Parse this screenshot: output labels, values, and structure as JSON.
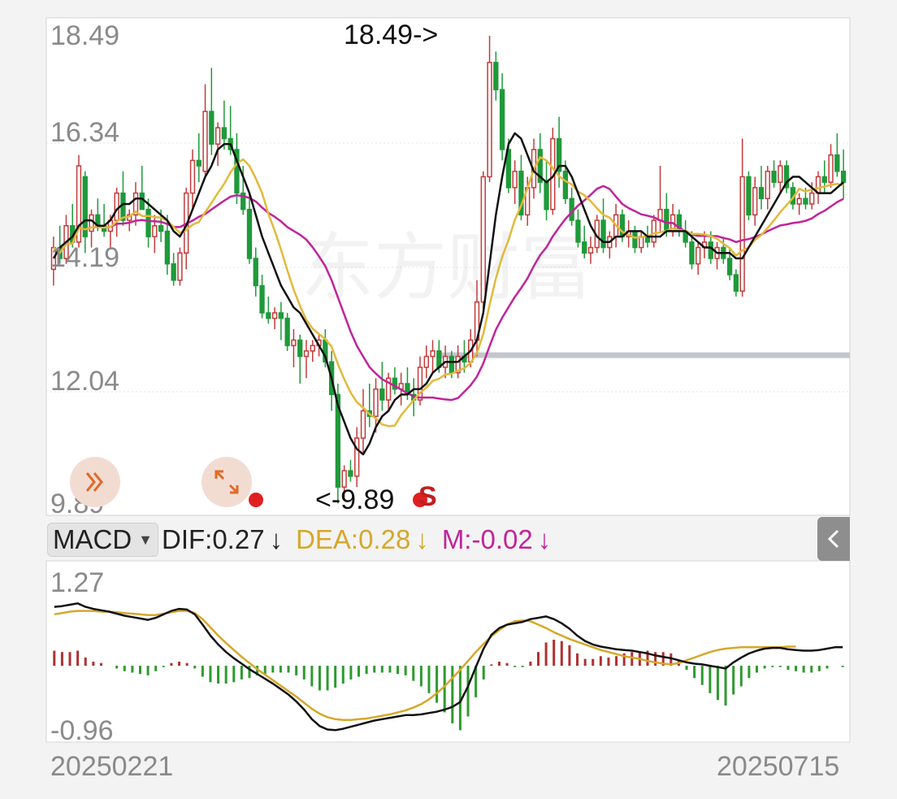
{
  "header": {
    "indicator": "MACD"
  },
  "price_axis": {
    "labels": [
      "18.49",
      "16.34",
      "14.19",
      "12.04",
      "9.89"
    ]
  },
  "annotations": {
    "high": "18.49->",
    "low": "<-9.89",
    "signal": "S",
    "watermark": "东方财富"
  },
  "macd_info": {
    "dif": "DIF:0.27",
    "dea": "DEA:0.28",
    "m": "M:-0.02",
    "arrow": "↓"
  },
  "macd_axis": {
    "top": "1.27",
    "bottom": "-0.96"
  },
  "dates": {
    "start": "20250221",
    "end": "20250715"
  },
  "icons": {
    "forward": "double-chevron-right-icon",
    "expand": "expand-arrows-icon",
    "collapse": "chevron-left-icon"
  },
  "colors": {
    "up": "#c23b3b",
    "down": "#1f9a3a",
    "ma5": "#111111",
    "ma10": "#e2b93b",
    "ma20": "#c0249a",
    "dea": "#d6a72a",
    "macd_up": "#b03030",
    "macd_down": "#2e9a2e",
    "dot": "#e02020",
    "grid": "#dddddd",
    "hline": "#c4c4c4"
  },
  "chart_data": [
    {
      "type": "candlestick",
      "title": "",
      "ylim": [
        9.89,
        18.49
      ],
      "y_ticks": [
        18.49,
        16.34,
        14.19,
        12.04,
        9.89
      ],
      "x_range": [
        "20250221",
        "20250715"
      ],
      "grid": true,
      "candles": [
        [
          14.2,
          14.8,
          13.9,
          14.6
        ],
        [
          14.6,
          15.0,
          14.3,
          14.4
        ],
        [
          14.4,
          15.2,
          14.3,
          15.0
        ],
        [
          15.0,
          15.4,
          14.6,
          14.7
        ],
        [
          14.7,
          16.3,
          14.6,
          16.1
        ],
        [
          15.9,
          16.0,
          14.5,
          14.8
        ],
        [
          14.9,
          15.3,
          14.6,
          15.2
        ],
        [
          15.2,
          15.5,
          14.9,
          15.0
        ],
        [
          15.0,
          15.4,
          14.8,
          14.9
        ],
        [
          14.9,
          15.2,
          14.6,
          15.1
        ],
        [
          15.1,
          15.7,
          14.8,
          15.6
        ],
        [
          15.6,
          16.0,
          15.0,
          15.1
        ],
        [
          15.1,
          15.3,
          14.9,
          15.2
        ],
        [
          15.2,
          15.8,
          15.0,
          15.6
        ],
        [
          15.6,
          16.1,
          15.4,
          15.3
        ],
        [
          15.3,
          15.5,
          14.6,
          14.8
        ],
        [
          14.8,
          15.2,
          14.5,
          15.0
        ],
        [
          15.0,
          15.3,
          14.7,
          14.9
        ],
        [
          14.9,
          15.2,
          14.1,
          14.3
        ],
        [
          14.3,
          14.5,
          13.9,
          14.0
        ],
        [
          14.0,
          14.6,
          13.9,
          14.5
        ],
        [
          14.5,
          15.7,
          14.2,
          15.6
        ],
        [
          15.6,
          16.4,
          15.3,
          16.2
        ],
        [
          16.2,
          16.7,
          15.8,
          16.1
        ],
        [
          16.0,
          17.6,
          15.9,
          17.1
        ],
        [
          17.1,
          17.9,
          16.3,
          16.5
        ],
        [
          16.5,
          16.9,
          16.1,
          16.8
        ],
        [
          16.8,
          17.3,
          16.4,
          16.6
        ],
        [
          16.6,
          17.2,
          16.3,
          16.4
        ],
        [
          16.4,
          16.7,
          15.4,
          15.6
        ],
        [
          15.6,
          16.1,
          15.2,
          15.3
        ],
        [
          15.3,
          15.6,
          14.3,
          14.4
        ],
        [
          14.4,
          14.6,
          13.7,
          13.9
        ],
        [
          13.9,
          14.1,
          13.3,
          13.4
        ],
        [
          13.4,
          13.7,
          13.2,
          13.3
        ],
        [
          13.3,
          13.5,
          13.1,
          13.4
        ],
        [
          13.4,
          13.6,
          12.9,
          13.3
        ],
        [
          13.3,
          13.4,
          12.7,
          12.8
        ],
        [
          12.8,
          13.1,
          12.4,
          12.9
        ],
        [
          12.9,
          13.0,
          12.1,
          12.6
        ],
        [
          12.6,
          12.9,
          12.2,
          12.7
        ],
        [
          12.7,
          12.9,
          12.5,
          12.8
        ],
        [
          12.8,
          13.0,
          12.6,
          12.9
        ],
        [
          12.9,
          13.1,
          12.4,
          12.5
        ],
        [
          12.5,
          12.7,
          11.6,
          11.9
        ],
        [
          11.9,
          12.1,
          9.9,
          10.2
        ],
        [
          10.2,
          10.6,
          10.0,
          10.5
        ],
        [
          10.5,
          10.7,
          10.3,
          10.4
        ],
        [
          10.4,
          11.3,
          10.2,
          11.1
        ],
        [
          11.1,
          12.0,
          10.8,
          11.6
        ],
        [
          11.6,
          12.1,
          11.3,
          11.5
        ],
        [
          11.5,
          12.2,
          11.2,
          12.0
        ],
        [
          12.0,
          12.5,
          11.6,
          11.8
        ],
        [
          11.8,
          12.3,
          11.6,
          12.2
        ],
        [
          12.2,
          12.4,
          11.9,
          12.0
        ],
        [
          12.0,
          12.3,
          11.7,
          12.1
        ],
        [
          12.1,
          12.4,
          11.8,
          11.9
        ],
        [
          11.9,
          12.2,
          11.5,
          11.8
        ],
        [
          11.8,
          12.6,
          11.7,
          12.4
        ],
        [
          12.4,
          12.8,
          12.2,
          12.6
        ],
        [
          12.6,
          12.9,
          12.3,
          12.7
        ],
        [
          12.7,
          12.9,
          12.3,
          12.4
        ],
        [
          12.4,
          12.8,
          12.2,
          12.6
        ],
        [
          12.6,
          12.7,
          12.2,
          12.3
        ],
        [
          12.3,
          12.8,
          12.2,
          12.6
        ],
        [
          12.6,
          12.9,
          12.3,
          12.5
        ],
        [
          12.5,
          13.1,
          12.4,
          12.9
        ],
        [
          12.9,
          14.0,
          12.6,
          13.6
        ],
        [
          13.6,
          16.0,
          13.4,
          15.9
        ],
        [
          15.9,
          18.49,
          15.8,
          18.0
        ],
        [
          18.0,
          18.2,
          17.3,
          17.5
        ],
        [
          17.5,
          17.8,
          16.2,
          16.4
        ],
        [
          16.4,
          16.6,
          15.6,
          15.7
        ],
        [
          15.7,
          16.2,
          15.4,
          16.0
        ],
        [
          16.0,
          16.3,
          15.1,
          15.2
        ],
        [
          15.2,
          15.9,
          15.0,
          15.7
        ],
        [
          15.7,
          16.6,
          15.5,
          16.4
        ],
        [
          16.4,
          16.7,
          15.6,
          15.8
        ],
        [
          15.8,
          16.2,
          15.1,
          15.3
        ],
        [
          15.3,
          16.8,
          15.2,
          16.6
        ],
        [
          16.6,
          17.0,
          15.7,
          16.0
        ],
        [
          16.0,
          16.2,
          15.4,
          15.5
        ],
        [
          15.5,
          15.7,
          15.0,
          15.1
        ],
        [
          15.1,
          15.3,
          14.6,
          14.7
        ],
        [
          14.7,
          15.0,
          14.4,
          14.5
        ],
        [
          14.5,
          14.8,
          14.3,
          14.6
        ],
        [
          14.6,
          15.2,
          14.5,
          15.1
        ],
        [
          15.1,
          15.5,
          14.5,
          14.6
        ],
        [
          14.6,
          14.9,
          14.4,
          14.8
        ],
        [
          14.8,
          15.4,
          14.6,
          15.2
        ],
        [
          15.2,
          15.3,
          14.7,
          14.8
        ],
        [
          14.8,
          15.1,
          14.6,
          14.9
        ],
        [
          14.9,
          15.0,
          14.5,
          14.6
        ],
        [
          14.6,
          14.9,
          14.5,
          14.8
        ],
        [
          14.8,
          15.0,
          14.6,
          14.7
        ],
        [
          14.7,
          15.2,
          14.6,
          15.1
        ],
        [
          15.1,
          16.1,
          14.9,
          15.3
        ],
        [
          15.3,
          15.6,
          14.8,
          14.9
        ],
        [
          14.9,
          15.4,
          14.8,
          15.2
        ],
        [
          15.2,
          15.3,
          14.8,
          14.9
        ],
        [
          14.9,
          15.1,
          14.6,
          14.7
        ],
        [
          14.7,
          14.9,
          14.2,
          14.3
        ],
        [
          14.3,
          14.7,
          14.1,
          14.6
        ],
        [
          14.6,
          14.9,
          14.4,
          14.7
        ],
        [
          14.7,
          14.9,
          14.3,
          14.4
        ],
        [
          14.4,
          14.7,
          14.2,
          14.6
        ],
        [
          14.6,
          14.8,
          14.3,
          14.4
        ],
        [
          14.4,
          14.6,
          14.0,
          14.1
        ],
        [
          14.1,
          14.2,
          13.7,
          13.8
        ],
        [
          13.8,
          16.6,
          13.7,
          15.9
        ],
        [
          15.9,
          16.0,
          15.1,
          15.2
        ],
        [
          15.2,
          15.9,
          15.0,
          15.7
        ],
        [
          15.7,
          16.1,
          15.3,
          15.5
        ],
        [
          15.5,
          16.1,
          15.3,
          16.0
        ],
        [
          16.0,
          16.2,
          15.7,
          15.8
        ],
        [
          15.8,
          16.2,
          15.6,
          16.1
        ],
        [
          16.1,
          16.2,
          15.6,
          15.7
        ],
        [
          15.7,
          15.8,
          15.3,
          15.4
        ],
        [
          15.4,
          15.6,
          15.2,
          15.5
        ],
        [
          15.5,
          15.7,
          15.3,
          15.4
        ],
        [
          15.4,
          15.8,
          15.3,
          15.6
        ],
        [
          15.6,
          16.0,
          15.4,
          15.9
        ],
        [
          15.9,
          16.2,
          15.6,
          15.8
        ],
        [
          15.8,
          16.5,
          15.7,
          16.3
        ],
        [
          16.3,
          16.7,
          15.9,
          16.0
        ],
        [
          16.0,
          16.4,
          15.5,
          15.8
        ]
      ],
      "ma5": [
        14.4,
        14.6,
        14.7,
        14.8,
        15.0,
        15.1,
        15.1,
        15.0,
        15.0,
        15.1,
        15.3,
        15.4,
        15.4,
        15.5,
        15.5,
        15.4,
        15.3,
        15.2,
        15.1,
        14.9,
        14.8,
        15.0,
        15.3,
        15.6,
        15.9,
        16.1,
        16.4,
        16.5,
        16.5,
        16.2,
        15.9,
        15.6,
        15.2,
        14.8,
        14.5,
        14.2,
        13.9,
        13.7,
        13.5,
        13.4,
        13.2,
        13.0,
        12.8,
        12.6,
        12.2,
        11.7,
        11.4,
        11.1,
        10.9,
        10.8,
        11.0,
        11.3,
        11.5,
        11.6,
        11.8,
        11.9,
        11.9,
        12.0,
        12.0,
        12.1,
        12.3,
        12.4,
        12.5,
        12.5,
        12.5,
        12.6,
        12.7,
        12.9,
        13.4,
        14.3,
        15.2,
        15.9,
        16.5,
        16.7,
        16.6,
        16.3,
        16.0,
        15.9,
        15.8,
        15.9,
        16.1,
        16.1,
        15.9,
        15.6,
        15.3,
        15.0,
        14.8,
        14.7,
        14.7,
        14.8,
        14.8,
        14.9,
        14.9,
        14.9,
        14.8,
        14.8,
        14.8,
        14.9,
        14.9,
        14.9,
        14.9,
        14.8,
        14.7,
        14.6,
        14.6,
        14.5,
        14.5,
        14.5,
        14.4,
        14.4,
        14.6,
        14.8,
        15.0,
        15.2,
        15.4,
        15.6,
        15.8,
        15.9,
        15.9,
        15.8,
        15.7,
        15.6,
        15.6,
        15.6,
        15.7,
        15.8,
        15.8,
        15.8
      ]
    },
    {
      "type": "bar",
      "title": "MACD",
      "ylim": [
        -0.96,
        1.27
      ],
      "series": [
        {
          "name": "DIF",
          "values": [
            0.86,
            0.87,
            0.89,
            0.91,
            0.86,
            0.83,
            0.81,
            0.79,
            0.76,
            0.73,
            0.71,
            0.69,
            0.67,
            0.7,
            0.75,
            0.8,
            0.83,
            0.82,
            0.75,
            0.6,
            0.44,
            0.31,
            0.2,
            0.11,
            0.03,
            -0.05,
            -0.12,
            -0.19,
            -0.26,
            -0.34,
            -0.42,
            -0.52,
            -0.64,
            -0.78,
            -0.88,
            -0.93,
            -0.94,
            -0.92,
            -0.89,
            -0.86,
            -0.83,
            -0.8,
            -0.78,
            -0.76,
            -0.74,
            -0.72,
            -0.72,
            -0.71,
            -0.69,
            -0.67,
            -0.64,
            -0.6,
            -0.53,
            -0.3,
            -0.02,
            0.25,
            0.45,
            0.55,
            0.6,
            0.62,
            0.64,
            0.68,
            0.7,
            0.72,
            0.68,
            0.62,
            0.54,
            0.44,
            0.36,
            0.31,
            0.28,
            0.26,
            0.24,
            0.23,
            0.22,
            0.2,
            0.18,
            0.15,
            0.13,
            0.11,
            0.08,
            0.05,
            0.03,
            0.02,
            0.0,
            -0.02,
            -0.04,
            0.05,
            0.12,
            0.18,
            0.22,
            0.25,
            0.26,
            0.26,
            0.24,
            0.23,
            0.22,
            0.22,
            0.23,
            0.25,
            0.27,
            0.27
          ]
        },
        {
          "name": "DEA",
          "values": [
            0.75,
            0.77,
            0.79,
            0.8,
            0.8,
            0.8,
            0.79,
            0.79,
            0.78,
            0.77,
            0.76,
            0.75,
            0.74,
            0.74,
            0.76,
            0.78,
            0.8,
            0.8,
            0.77,
            0.68,
            0.56,
            0.44,
            0.33,
            0.23,
            0.13,
            0.04,
            -0.05,
            -0.13,
            -0.21,
            -0.29,
            -0.37,
            -0.45,
            -0.54,
            -0.63,
            -0.7,
            -0.75,
            -0.78,
            -0.79,
            -0.79,
            -0.78,
            -0.77,
            -0.75,
            -0.73,
            -0.71,
            -0.68,
            -0.65,
            -0.61,
            -0.56,
            -0.49,
            -0.4,
            -0.3,
            -0.18,
            -0.06,
            0.07,
            0.2,
            0.32,
            0.43,
            0.52,
            0.6,
            0.65,
            0.66,
            0.65,
            0.6,
            0.55,
            0.49,
            0.44,
            0.39,
            0.35,
            0.31,
            0.27,
            0.23,
            0.2,
            0.17,
            0.14,
            0.12,
            0.1,
            0.07,
            0.05,
            0.03,
            0.02,
            0.04,
            0.08,
            0.12,
            0.16,
            0.2,
            0.23,
            0.25,
            0.26,
            0.27,
            0.27,
            0.27,
            0.27,
            0.27,
            0.27,
            0.28,
            0.28
          ]
        },
        {
          "name": "M",
          "values": [
            0.22,
            0.2,
            0.2,
            0.22,
            0.12,
            0.06,
            0.04,
            0.0,
            -0.04,
            -0.08,
            -0.1,
            -0.12,
            -0.14,
            -0.08,
            -0.02,
            0.04,
            0.06,
            0.04,
            -0.04,
            -0.16,
            -0.24,
            -0.26,
            -0.26,
            -0.24,
            -0.2,
            -0.18,
            -0.14,
            -0.12,
            -0.1,
            -0.1,
            -0.1,
            -0.14,
            -0.2,
            -0.3,
            -0.36,
            -0.36,
            -0.32,
            -0.26,
            -0.2,
            -0.16,
            -0.12,
            -0.1,
            -0.1,
            -0.1,
            -0.12,
            -0.14,
            -0.22,
            -0.3,
            -0.4,
            -0.54,
            -0.68,
            -0.84,
            -0.94,
            -0.74,
            -0.46,
            -0.2,
            0.02,
            0.06,
            0.04,
            -0.02,
            -0.02,
            0.06,
            0.2,
            0.34,
            0.38,
            0.36,
            0.3,
            0.18,
            0.1,
            0.1,
            0.14,
            0.12,
            0.14,
            0.18,
            0.2,
            0.2,
            0.22,
            0.2,
            0.2,
            0.18,
            0.08,
            -0.06,
            -0.18,
            -0.28,
            -0.4,
            -0.5,
            -0.58,
            -0.42,
            -0.3,
            -0.18,
            -0.1,
            -0.04,
            -0.02,
            -0.02,
            -0.06,
            -0.08,
            -0.1,
            -0.1,
            -0.08,
            -0.04,
            0.0,
            -0.02
          ]
        }
      ]
    }
  ]
}
